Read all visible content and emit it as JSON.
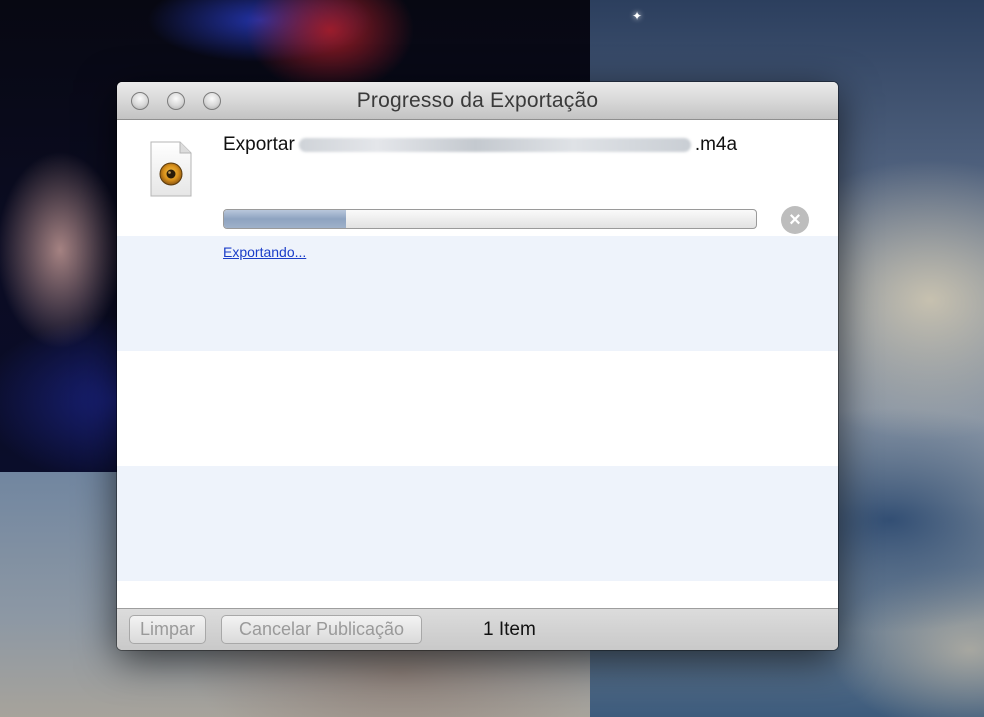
{
  "window": {
    "title": "Progresso da Exportação"
  },
  "item": {
    "title_prefix": "Exportar",
    "title_suffix": ".m4a",
    "status": "Exportando...",
    "progress_fraction": 0.23,
    "icon": "audio-file-icon"
  },
  "footer": {
    "clear_label": "Limpar",
    "cancel_publish_label": "Cancelar Publicação",
    "item_count": "1 Item"
  },
  "colors": {
    "link": "#1b3ec9",
    "alt_row": "#eef3fb",
    "progress_fill": "#8ea3c0"
  }
}
